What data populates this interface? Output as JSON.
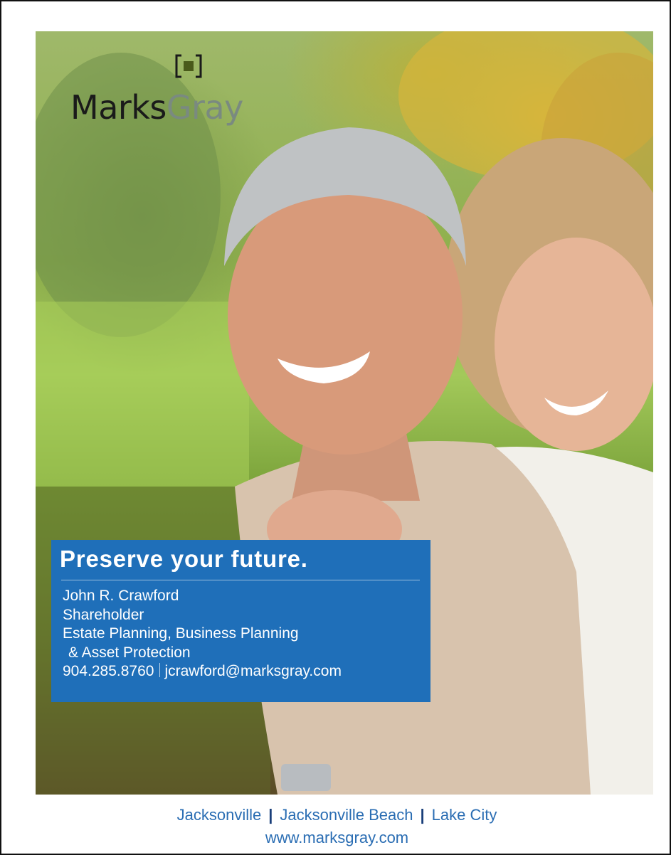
{
  "logo": {
    "brand_part1": "Marks",
    "brand_part2": "Gray",
    "mark_color": "#4a5a1a",
    "bracket_color": "#1a1a1a"
  },
  "ad": {
    "headline": "Preserve your future.",
    "contact": {
      "name": "John R. Crawford",
      "title": "Shareholder",
      "practice_line1": "Estate Planning, Business Planning",
      "practice_line2": "& Asset Protection",
      "phone": "904.285.8760",
      "email": "jcrawford@marksgray.com"
    },
    "box_color": "#1f6fb9"
  },
  "footer": {
    "locations": [
      "Jacksonville",
      "Jacksonville Beach",
      "Lake City"
    ],
    "separator": "|",
    "website": "www.marksgray.com",
    "text_color": "#2a6db3"
  }
}
